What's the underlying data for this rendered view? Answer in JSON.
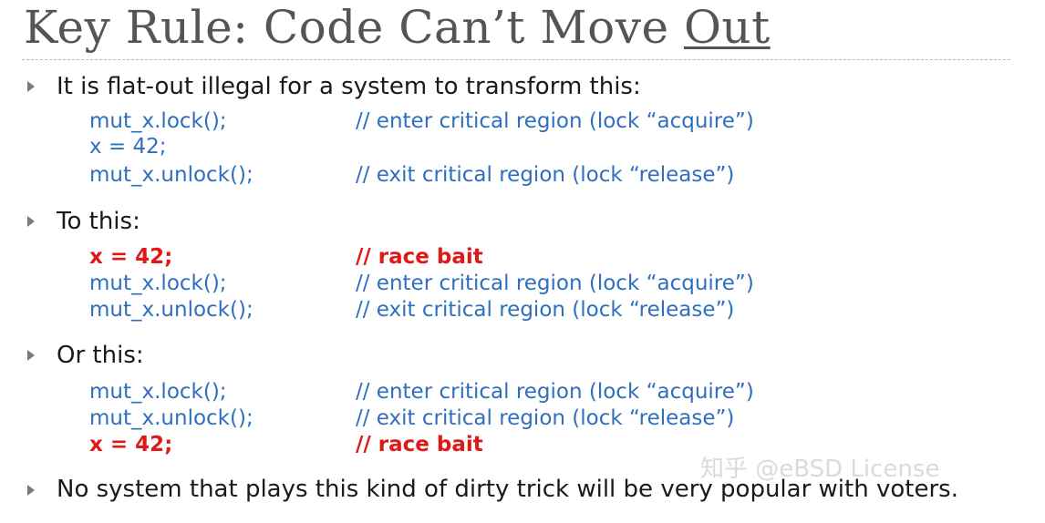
{
  "slide": {
    "title_main": "Key Rule: Code Can’t Move ",
    "title_underlined": "Out",
    "bullets": [
      "It is flat-out illegal for a system to transform this:",
      "To this:",
      "Or this:",
      "No system that plays this kind of dirty trick will be very popular with voters."
    ],
    "block1": [
      {
        "code": "mut_x.lock();",
        "comment": "// enter critical region (lock “acquire”)"
      },
      {
        "code": "x = 42;",
        "comment": ""
      },
      {
        "code": "mut_x.unlock();",
        "comment": "// exit critical region (lock “release”)"
      }
    ],
    "block2": [
      {
        "code": "x = 42;",
        "comment": "// race bait"
      },
      {
        "code": "mut_x.lock();",
        "comment": "// enter critical region (lock “acquire”)"
      },
      {
        "code": "mut_x.unlock();",
        "comment": "// exit critical region (lock “release”)"
      }
    ],
    "block3": [
      {
        "code": "mut_x.lock();",
        "comment": "// enter critical region (lock “acquire”)"
      },
      {
        "code": "mut_x.unlock();",
        "comment": "// exit critical region (lock “release”)"
      },
      {
        "code": "x = 42;",
        "comment": "// race bait"
      }
    ]
  },
  "watermark": "知乎 @eBSD License",
  "colors": {
    "code_blue": "#2f6fbe",
    "race_red": "#e01818",
    "title_gray": "#555555"
  }
}
